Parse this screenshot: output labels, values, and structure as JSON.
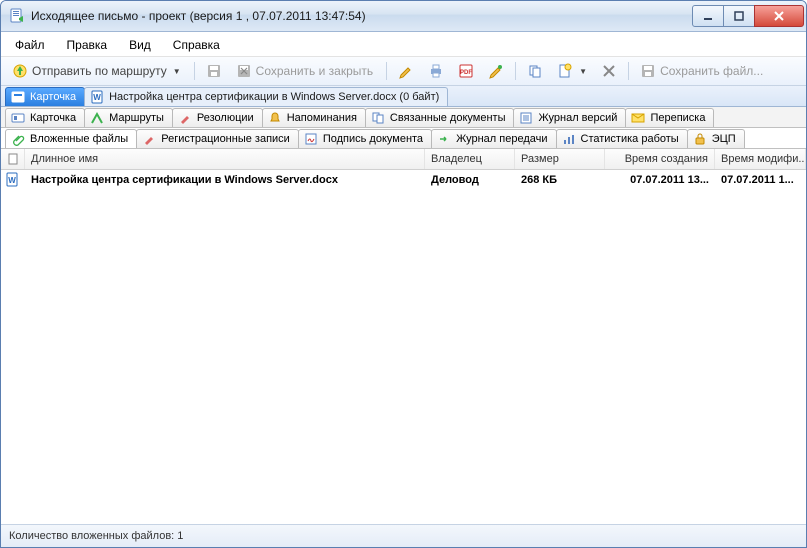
{
  "window": {
    "title": "Исходящее письмо - проект (версия 1 , 07.07.2011 13:47:54)"
  },
  "menu": {
    "file": "Файл",
    "edit": "Правка",
    "view": "Вид",
    "help": "Справка"
  },
  "toolbar": {
    "send_route": "Отправить по маршруту",
    "save_and_close": "Сохранить и закрыть",
    "save_file": "Сохранить файл..."
  },
  "top_tabs": {
    "card": "Карточка",
    "doc_name": "Настройка центра сертификации в Windows Server.docx (0 байт)"
  },
  "tabs_row1": {
    "card": "Карточка",
    "routes": "Маршруты",
    "resolutions": "Резолюции",
    "reminders": "Напоминания",
    "related": "Связанные документы",
    "versions": "Журнал версий",
    "correspond": "Переписка"
  },
  "tabs_row2": {
    "attachments": "Вложенные файлы",
    "reg_records": "Регистрационные записи",
    "signature": "Подпись документа",
    "transfer": "Журнал передачи",
    "stats": "Статистика работы",
    "ecp": "ЭЦП"
  },
  "columns": {
    "name": "Длинное имя",
    "owner": "Владелец",
    "size": "Размер",
    "ctime": "Время создания",
    "mtime": "Время модифи..."
  },
  "files": [
    {
      "name": "Настройка центра сертификации в Windows Server.docx",
      "owner": "Деловод",
      "size": "268 КБ",
      "ctime": "07.07.2011 13...",
      "mtime": "07.07.2011 1..."
    }
  ],
  "status": {
    "attachment_count": "Количество вложенных файлов: 1"
  }
}
